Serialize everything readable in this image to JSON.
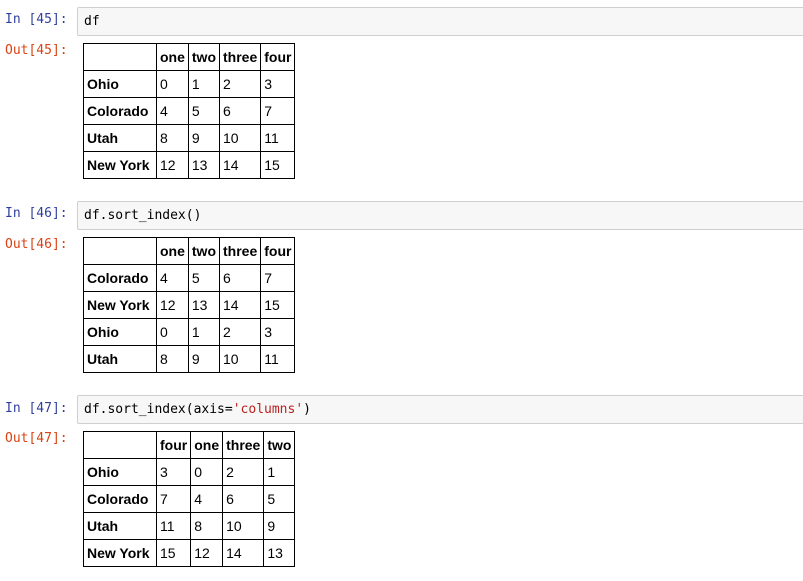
{
  "cells": [
    {
      "in_prompt": "In [45]:",
      "code": "df",
      "code_str": "",
      "code_end": "",
      "out_prompt": "Out[45]:",
      "columns": [
        "one",
        "two",
        "three",
        "four"
      ],
      "rows": [
        {
          "index": "Ohio",
          "values": [
            "0",
            "1",
            "2",
            "3"
          ]
        },
        {
          "index": "Colorado",
          "values": [
            "4",
            "5",
            "6",
            "7"
          ]
        },
        {
          "index": "Utah",
          "values": [
            "8",
            "9",
            "10",
            "11"
          ]
        },
        {
          "index": "New York",
          "values": [
            "12",
            "13",
            "14",
            "15"
          ]
        }
      ]
    },
    {
      "in_prompt": "In [46]:",
      "code": "df.sort_index()",
      "code_str": "",
      "code_end": "",
      "out_prompt": "Out[46]:",
      "columns": [
        "one",
        "two",
        "three",
        "four"
      ],
      "rows": [
        {
          "index": "Colorado",
          "values": [
            "4",
            "5",
            "6",
            "7"
          ]
        },
        {
          "index": "New York",
          "values": [
            "12",
            "13",
            "14",
            "15"
          ]
        },
        {
          "index": "Ohio",
          "values": [
            "0",
            "1",
            "2",
            "3"
          ]
        },
        {
          "index": "Utah",
          "values": [
            "8",
            "9",
            "10",
            "11"
          ]
        }
      ]
    },
    {
      "in_prompt": "In [47]:",
      "code": "df.sort_index(axis=",
      "code_str": "'columns'",
      "code_end": ")",
      "out_prompt": "Out[47]:",
      "columns": [
        "four",
        "one",
        "three",
        "two"
      ],
      "rows": [
        {
          "index": "Ohio",
          "values": [
            "3",
            "0",
            "2",
            "1"
          ]
        },
        {
          "index": "Colorado",
          "values": [
            "7",
            "4",
            "6",
            "5"
          ]
        },
        {
          "index": "Utah",
          "values": [
            "11",
            "8",
            "10",
            "9"
          ]
        },
        {
          "index": "New York",
          "values": [
            "15",
            "12",
            "14",
            "13"
          ]
        }
      ]
    }
  ]
}
